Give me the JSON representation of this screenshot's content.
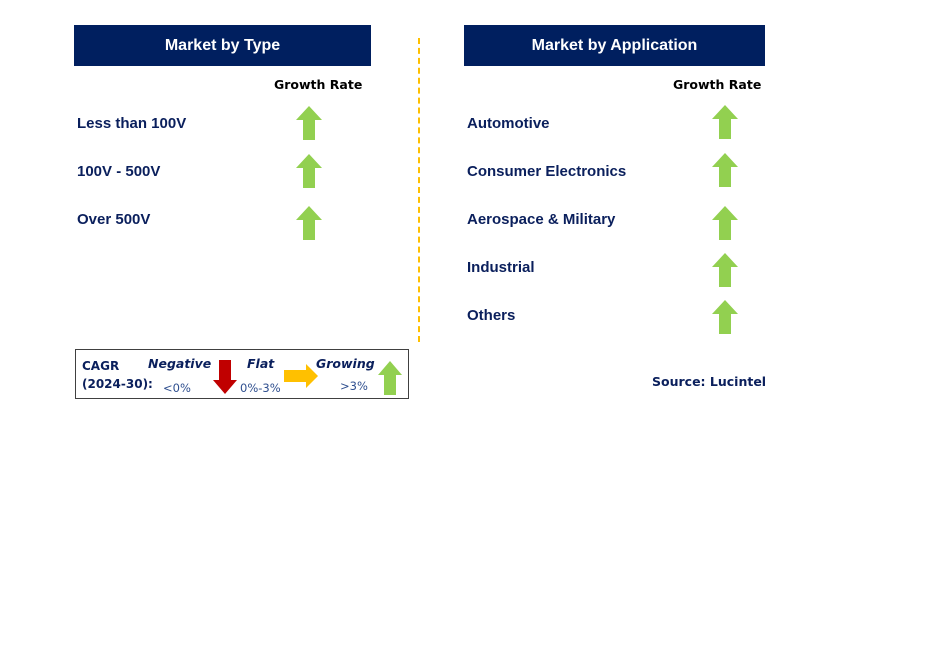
{
  "left_panel": {
    "title": "Market by Type",
    "column_header": "Growth Rate",
    "rows": [
      {
        "label": "Less than 100V",
        "trend": "growing"
      },
      {
        "label": "100V - 500V",
        "trend": "growing"
      },
      {
        "label": "Over 500V",
        "trend": "growing"
      }
    ]
  },
  "right_panel": {
    "title": "Market by Application",
    "column_header": "Growth Rate",
    "rows": [
      {
        "label": "Automotive",
        "trend": "growing"
      },
      {
        "label": "Consumer Electronics",
        "trend": "growing"
      },
      {
        "label": "Aerospace & Military",
        "trend": "growing"
      },
      {
        "label": "Industrial",
        "trend": "growing"
      },
      {
        "label": "Others",
        "trend": "growing"
      }
    ]
  },
  "legend": {
    "cagr_label": "CAGR",
    "period_label": "(2024-30):",
    "negative": {
      "label": "Negative",
      "range": "<0%",
      "icon": "arrow-down-icon",
      "color": "#c00000"
    },
    "flat": {
      "label": "Flat",
      "range": "0%-3%",
      "icon": "arrow-right-icon",
      "color": "#ffc000"
    },
    "growing": {
      "label": "Growing",
      "range": ">3%",
      "icon": "arrow-up-icon",
      "color": "#92d050"
    }
  },
  "source": "Source: Lucintel",
  "colors": {
    "header_bg": "#001f5f",
    "header_text": "#ffffff",
    "label_text": "#0a1f5c",
    "divider": "#ffc000",
    "growing": "#92d050",
    "flat": "#ffc000",
    "negative": "#c00000"
  }
}
